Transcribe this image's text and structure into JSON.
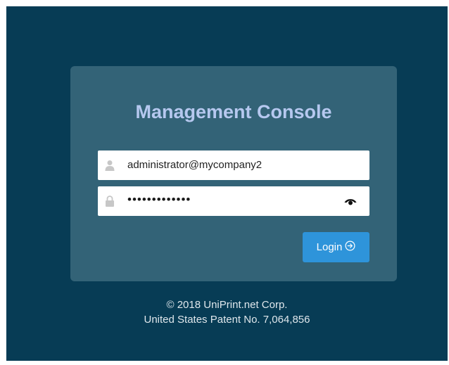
{
  "app": {
    "title": "Management Console"
  },
  "login_form": {
    "username": {
      "value": "administrator@mycompany2",
      "icon": "user-icon"
    },
    "password": {
      "masked_value": "•••••••••••••",
      "icon": "lock-icon",
      "toggle_icon": "eye-icon"
    },
    "submit": {
      "label": "Login",
      "icon": "arrow-circle-right-icon"
    }
  },
  "footer": {
    "copyright": "© 2018 UniPrint.net Corp.",
    "patent": "United States Patent No. 7,064,856"
  },
  "colors": {
    "background": "#073c55",
    "card": "#336377",
    "title": "#b6c8ef",
    "button": "#2e94da"
  }
}
